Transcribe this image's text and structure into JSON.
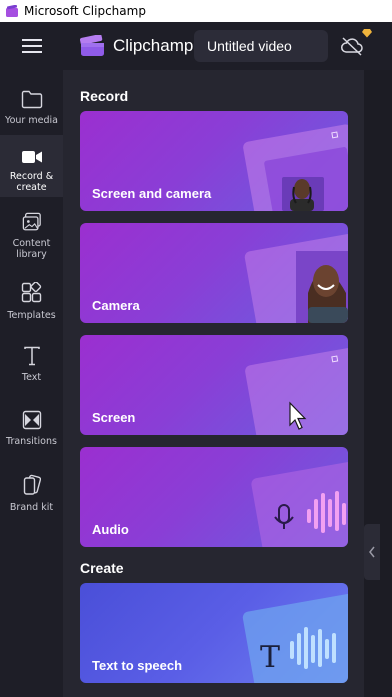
{
  "window": {
    "title": "Microsoft Clipchamp"
  },
  "header": {
    "brand": "Clipchamp",
    "project_title": "Untitled video"
  },
  "sidebar": {
    "items": [
      {
        "label": "Your media",
        "icon": "folder-icon"
      },
      {
        "label": "Record & create",
        "icon": "video-camera-icon",
        "active": true
      },
      {
        "label": "Content library",
        "icon": "content-library-icon"
      },
      {
        "label": "Templates",
        "icon": "templates-icon"
      },
      {
        "label": "Text",
        "icon": "text-icon"
      },
      {
        "label": "Transitions",
        "icon": "transitions-icon"
      },
      {
        "label": "Brand kit",
        "icon": "brand-kit-icon"
      }
    ]
  },
  "main": {
    "record_heading": "Record",
    "create_heading": "Create",
    "cards": [
      {
        "label": "Screen and camera"
      },
      {
        "label": "Camera"
      },
      {
        "label": "Screen"
      },
      {
        "label": "Audio"
      },
      {
        "label": "Text to speech"
      }
    ]
  },
  "colors": {
    "accent_purple": "#9b2fd0",
    "accent_blue": "#5a5ee6",
    "sidebar_bg": "#1e1e27",
    "panel_bg": "#262630"
  }
}
